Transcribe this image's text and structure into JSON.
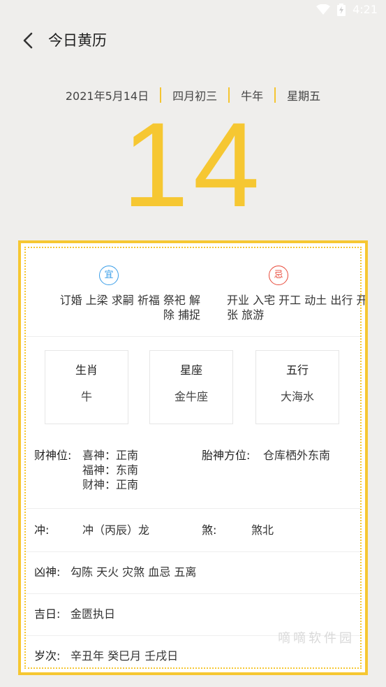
{
  "status_bar": {
    "time": "4:21",
    "icons": [
      "wifi-icon",
      "battery-icon"
    ]
  },
  "header": {
    "back_icon": "chevron-left-icon",
    "title": "今日黄历"
  },
  "date_line": {
    "solar_date": "2021年5月14日",
    "lunar_date": "四月初三",
    "zodiac_year": "牛年",
    "weekday": "星期五"
  },
  "big_day": "14",
  "yi_ji": {
    "yi_badge": "宜",
    "ji_badge": "忌",
    "yi_text": "订婚 上梁 求嗣 祈福 祭祀 解\n除 捕捉",
    "ji_text": "开业 入宅 开工 动土 出行 开\n张 旅游"
  },
  "attributes": [
    {
      "label": "生肖",
      "value": "牛"
    },
    {
      "label": "星座",
      "value": "金牛座"
    },
    {
      "label": "五行",
      "value": "大海水"
    }
  ],
  "wealth": {
    "label": "财神位:",
    "items": [
      "喜神：正南",
      "福神：东南",
      "财神：正南"
    ],
    "fetal_label": "胎神方位:",
    "fetal_value": "仓库栖外东南"
  },
  "chong": {
    "label": "冲:",
    "value": "冲（丙辰）龙",
    "sha_label": "煞:",
    "sha_value": "煞北"
  },
  "xiong_shen": {
    "label": "凶神:",
    "value": "勾陈 天火 灾煞 血忌 五离"
  },
  "ji_ri": {
    "label": "吉日:",
    "value": "金匮执日"
  },
  "sui_ci": {
    "label": "岁次:",
    "value": "辛丑年  癸巳月  壬戌日"
  },
  "watermark": "嘀嘀软件园",
  "colors": {
    "accent": "#f6c732",
    "yi": "#3a9ee8",
    "ji": "#e84a3a",
    "background": "#efeeec"
  }
}
